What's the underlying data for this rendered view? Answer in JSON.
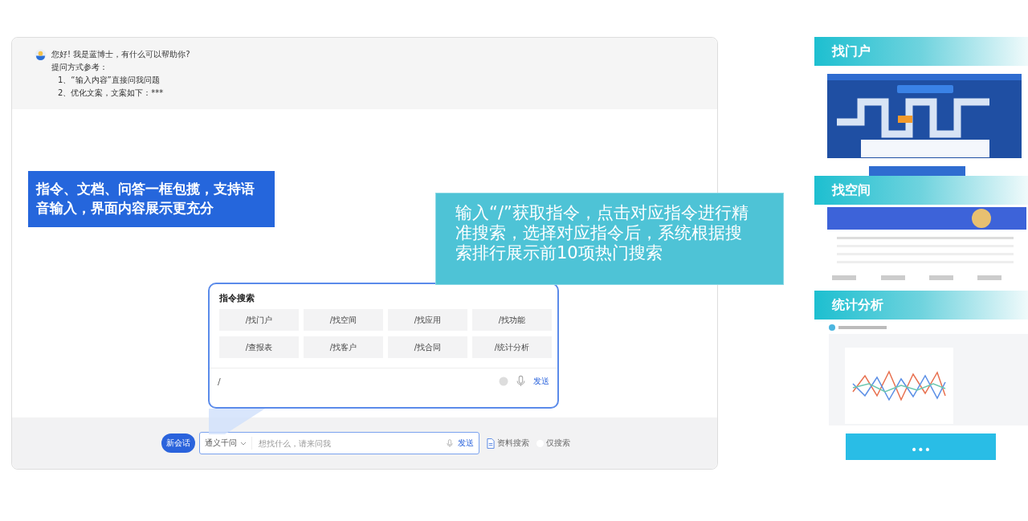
{
  "chat": {
    "greeting": "您好! 我是蓝博士，有什么可以帮助你?",
    "hint_title": "提问方式参考：",
    "hints": [
      "1、“输入内容”直接问我问题",
      "2、优化文案，文案如下：***"
    ]
  },
  "callouts": [
    {
      "kind": "blue",
      "text": "指令、文档、问答一框包揽，支持语音输入，界面内容展示更充分"
    },
    {
      "kind": "cyan",
      "text": "输入“/”获取指令，点击对应指令进行精准搜索，选择对应指令后，系统根据搜索排行展示前10项热门搜索"
    }
  ],
  "command_popup": {
    "title": "指令搜索",
    "commands": [
      "/找门户",
      "/找空间",
      "/找应用",
      "/找功能",
      "/查报表",
      "/找客户",
      "/找合同",
      "/统计分析"
    ],
    "input_value": "/",
    "send": "发送"
  },
  "composer": {
    "new_chat": "新会话",
    "model": "通义千问",
    "placeholder": "想找什么，请来问我",
    "send": "发送",
    "options": [
      {
        "kind": "doc",
        "label": "资料搜索"
      },
      {
        "kind": "toggle",
        "label": "仅搜索",
        "on": false
      }
    ]
  },
  "showcase": [
    {
      "kind": "portal",
      "title": "找门户"
    },
    {
      "kind": "space",
      "title": "找空间"
    },
    {
      "kind": "stats",
      "title": "统计分析"
    }
  ],
  "more_button": "•••"
}
